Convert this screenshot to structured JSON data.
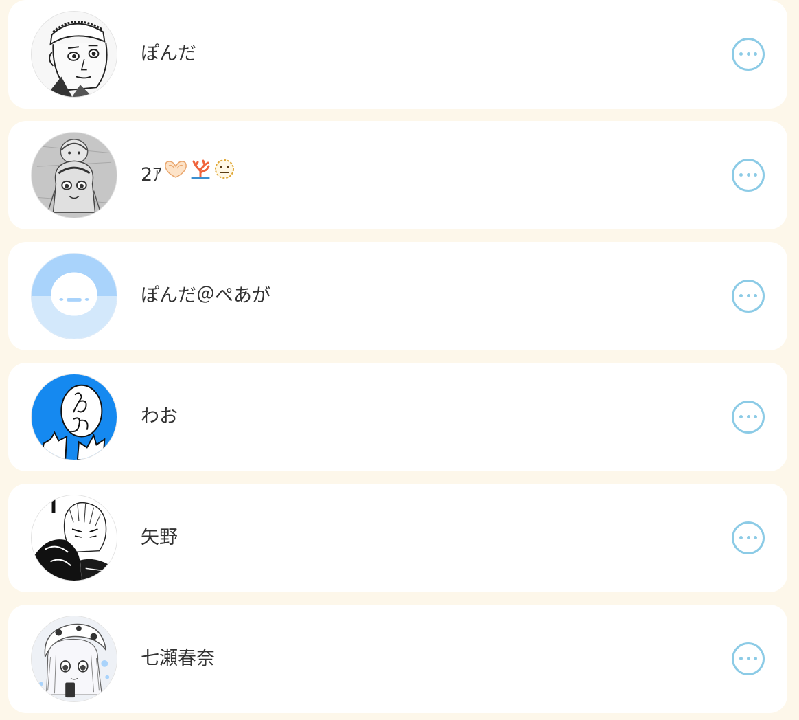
{
  "colors": {
    "page_background": "#fdf7ea",
    "card_background": "#ffffff",
    "accent": "#8ccbe6",
    "text": "#333333"
  },
  "users": [
    {
      "name": "ぽんだ",
      "avatar": "manga-man-headband-avatar",
      "more_icon": "more-options-icon"
    },
    {
      "name": "2ｱ",
      "avatar": "sketch-girl-pencil-avatar",
      "more_icon": "more-options-icon",
      "emoji": [
        "heart-hands-emoji",
        "coral-emoji",
        "dotted-line-face-emoji"
      ]
    },
    {
      "name": "ぽんだ＠ぺあが",
      "avatar": "smiley-blue-default-avatar",
      "more_icon": "more-options-icon"
    },
    {
      "name": "わお",
      "avatar": "blue-doodle-wao-avatar",
      "more_icon": "more-options-icon"
    },
    {
      "name": "矢野",
      "avatar": "manga-boy-white-hair-avatar",
      "more_icon": "more-options-icon"
    },
    {
      "name": "七瀬春奈",
      "avatar": "manga-girl-animal-hood-avatar",
      "more_icon": "more-options-icon"
    }
  ]
}
